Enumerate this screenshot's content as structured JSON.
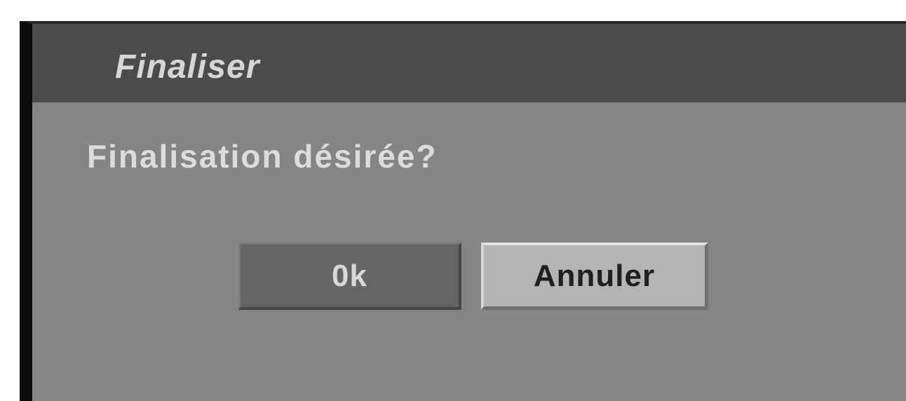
{
  "dialog": {
    "title": "Finaliser",
    "message": "Finalisation désirée?",
    "buttons": {
      "ok_label": "0k",
      "cancel_label": "Annuler"
    }
  },
  "colors": {
    "title_bar": "#4b4b4b",
    "dialog_background": "#858585",
    "ok_button": "#656565",
    "cancel_button_selected": "#b4b4b4"
  }
}
